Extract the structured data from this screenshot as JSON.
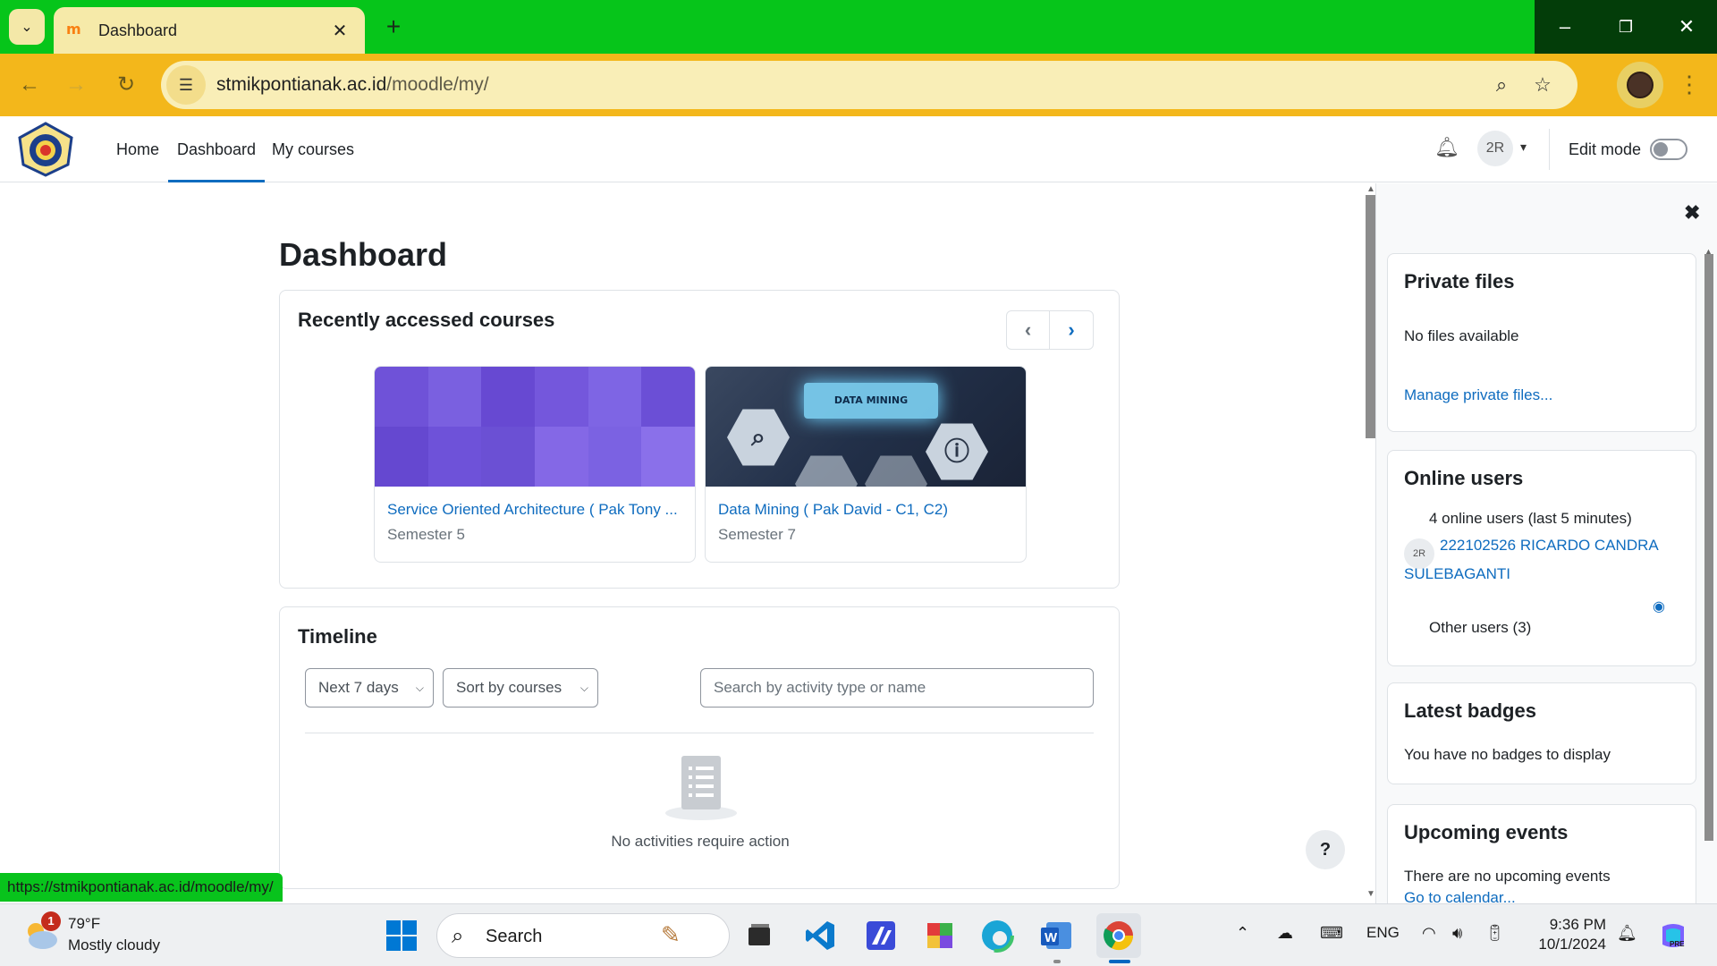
{
  "browser": {
    "tab_title": "Dashboard",
    "url_host": "stmikpontianak.ac.id",
    "url_path": "/moodle/my/",
    "status_url": "https://stmikpontianak.ac.id/moodle/my/"
  },
  "navbar": {
    "links": [
      "Home",
      "Dashboard",
      "My courses"
    ],
    "active_link": "Dashboard",
    "user_initials": "2R",
    "edit_mode_label": "Edit mode",
    "edit_mode_on": false
  },
  "main": {
    "page_title": "Dashboard",
    "recent": {
      "title": "Recently accessed courses",
      "courses": [
        {
          "name": "Service Oriented Architecture ( Pak Tony ...",
          "category": "Semester 5",
          "image_text": ""
        },
        {
          "name": "Data Mining ( Pak David - C1, C2)",
          "category": "Semester 7",
          "image_text": "DATA MINING"
        }
      ]
    },
    "timeline": {
      "title": "Timeline",
      "filter_days": "Next 7 days",
      "sort": "Sort by courses",
      "search_placeholder": "Search by activity type or name",
      "empty_message": "No activities require action"
    },
    "help_label": "?"
  },
  "drawer": {
    "private_files": {
      "title": "Private files",
      "empty": "No files available",
      "manage_link": "Manage private files..."
    },
    "online_users": {
      "title": "Online users",
      "summary": "4 online users (last 5 minutes)",
      "user_initials": "2R",
      "user_line1": "222102526 RICARDO CANDRA",
      "user_line2": "SULEBAGANTI",
      "other_users": "Other users (3)"
    },
    "latest_badges": {
      "title": "Latest badges",
      "empty": "You have no badges to display"
    },
    "upcoming_events": {
      "title": "Upcoming events",
      "empty": "There are no upcoming events",
      "calendar_link": "Go to calendar..."
    }
  },
  "taskbar": {
    "weather_badge": "1",
    "weather_temp": "79°F",
    "weather_desc": "Mostly cloudy",
    "search_label": "Search",
    "language": "ENG",
    "time": "9:36 PM",
    "date": "10/1/2024"
  },
  "colors": {
    "tabbar": "#06c51a",
    "addressbar": "#f3b71b",
    "moodle_link": "#0f6cbf",
    "course1_image": "#7b5ce0"
  }
}
